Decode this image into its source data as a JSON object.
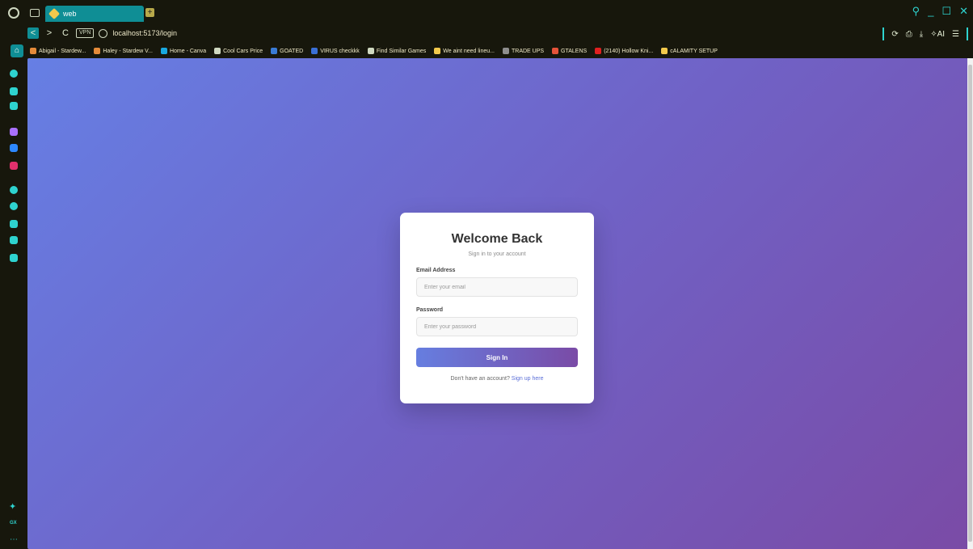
{
  "browser": {
    "tab_title": "web",
    "url": "localhost:5173/login",
    "vpn_label": "VPN",
    "ai_label": "AI",
    "colors": {
      "accent": "#0f8e95",
      "frame": "#17170c",
      "highlight": "#2ed3cf"
    }
  },
  "bookmarks": [
    {
      "label": "Abigail - Stardew...",
      "color": "#e58b3a"
    },
    {
      "label": "Haley - Stardew V...",
      "color": "#e58b3a"
    },
    {
      "label": "Home - Canva",
      "color": "#19a9e0"
    },
    {
      "label": "Cool Cars Price",
      "color": "#cfd8c0"
    },
    {
      "label": "GOATED",
      "color": "#3a7bd5"
    },
    {
      "label": "VIRUS checkkk",
      "color": "#3a6fd5"
    },
    {
      "label": "Find Similar Games",
      "color": "#cfd8c0"
    },
    {
      "label": "We aint need lineu...",
      "color": "#f2c94c"
    },
    {
      "label": "TRADE UPS",
      "color": "#8e8e8e"
    },
    {
      "label": "GTALENS",
      "color": "#e5533a"
    },
    {
      "label": "(2140) Hollow Kni...",
      "color": "#e02020"
    },
    {
      "label": "cALAMITY SETUP",
      "color": "#f2c94c"
    }
  ],
  "sidebar_icons": [
    {
      "name": "aria-icon",
      "color": "#2ed3cf"
    },
    {
      "name": "chat-icon",
      "color": "#2ed3cf"
    },
    {
      "name": "news-icon",
      "color": "#2ed3cf"
    },
    {
      "name": "twitch-icon",
      "color": "#a970ff"
    },
    {
      "name": "messenger-icon",
      "color": "#2d88ff"
    },
    {
      "name": "instagram-icon",
      "color": "#e1306c"
    },
    {
      "name": "spotify-icon",
      "color": "#2ed3cf"
    },
    {
      "name": "history-icon",
      "color": "#2ed3cf"
    },
    {
      "name": "downloads-icon",
      "color": "#2ed3cf"
    },
    {
      "name": "extensions-icon",
      "color": "#2ed3cf"
    },
    {
      "name": "settings-icon",
      "color": "#2ed3cf"
    }
  ],
  "login": {
    "title": "Welcome Back",
    "subtitle": "Sign in to your account",
    "email_label": "Email Address",
    "email_placeholder": "Enter your email",
    "email_value": "",
    "password_label": "Password",
    "password_placeholder": "Enter your password",
    "password_value": "",
    "submit_label": "Sign In",
    "footer_text": "Don't have an account?",
    "footer_link": "Sign up here",
    "colors": {
      "gradient_start": "#667fe4",
      "gradient_end": "#7a4ba6",
      "link": "#5b6fd8"
    }
  }
}
